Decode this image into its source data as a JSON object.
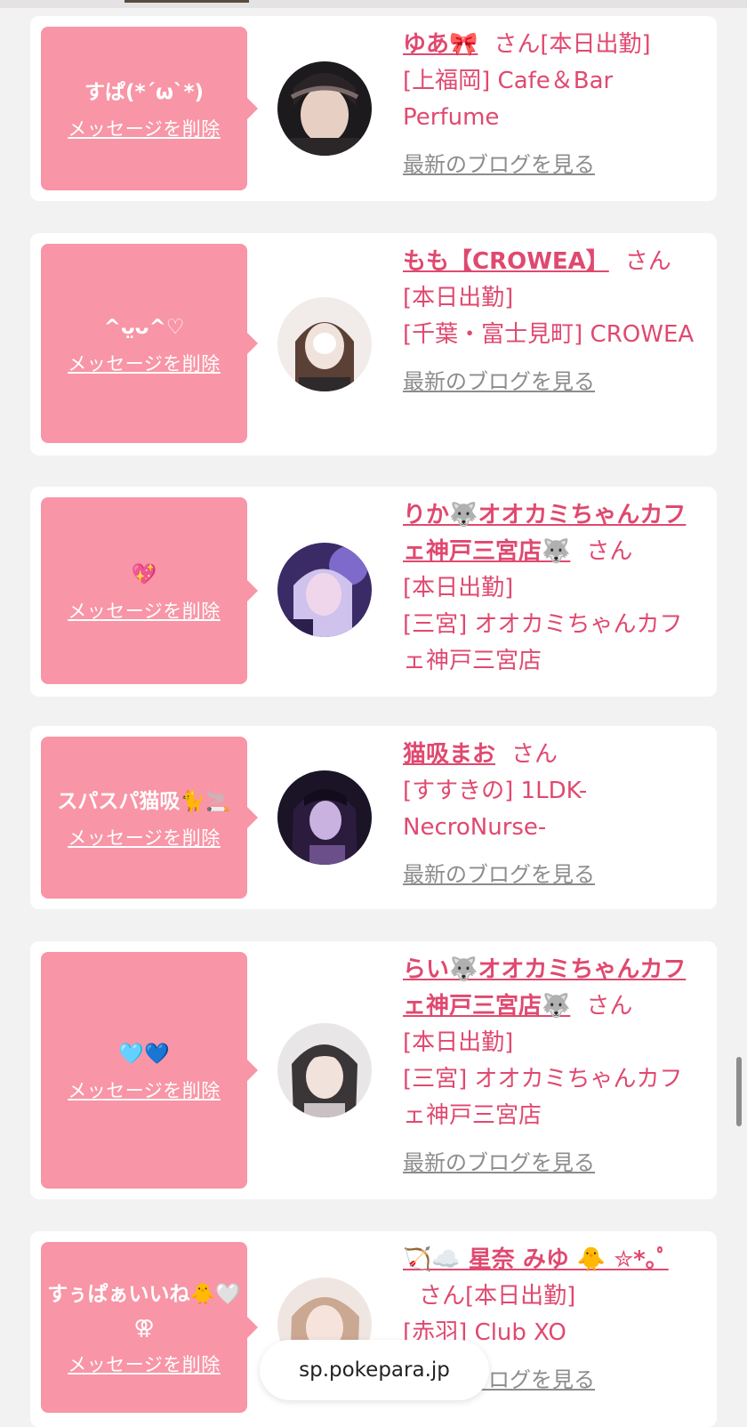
{
  "colors": {
    "accent": "#e0496f",
    "bubble": "#f895a6",
    "link_gray": "#8c8c8c",
    "page_bg": "#f3f2f2"
  },
  "cards": [
    {
      "message": "すぱ(*´ω`*)",
      "delete_label": "メッセージを削除",
      "name": "ゆあ🎀",
      "honorific": "さん",
      "status": "[本日出勤]",
      "shop": "[上福岡] Cafe＆Bar Perfume",
      "blog_label": "最新のブログを見る"
    },
    {
      "message": "^ᴗ̤ᴗ^♡",
      "delete_label": "メッセージを削除",
      "name": "もも【CROWEA】",
      "honorific": "さん",
      "status": "[本日出勤]",
      "shop": "[千葉・富士見町] CROWEA",
      "blog_label": "最新のブログを見る"
    },
    {
      "message": "💖",
      "delete_label": "メッセージを削除",
      "name": "りか🐺オオカミちゃんカフェ神戸三宮店🐺",
      "honorific": "さん",
      "status": "[本日出勤]",
      "shop": "[三宮] オオカミちゃんカフェ神戸三宮店",
      "blog_label": ""
    },
    {
      "message": "スパスパ猫吸🐈🚬",
      "delete_label": "メッセージを削除",
      "name": "猫吸まお",
      "honorific": "さん",
      "status": "",
      "shop": "[すすきの] 1LDK-NecroNurse-",
      "blog_label": "最新のブログを見る"
    },
    {
      "message": "🩵💙",
      "delete_label": "メッセージを削除",
      "name": "らい🐺オオカミちゃんカフェ神戸三宮店🐺",
      "honorific": "さん",
      "status": "[本日出勤]",
      "shop": "[三宮] オオカミちゃんカフェ神戸三宮店",
      "blog_label": "最新のブログを見る"
    },
    {
      "message": "すぅぱぁいいね🐥🤍⚢",
      "delete_label": "メッセージを削除",
      "name": "🏹☁️ 星奈 みゆ 🐥 ✮*｡ﾟ",
      "honorific": "さん",
      "status": "[本日出勤]",
      "shop": "[赤羽] Club XO",
      "blog_label": "最新のブログを見る"
    }
  ],
  "browser": {
    "url": "sp.pokepara.jp"
  }
}
